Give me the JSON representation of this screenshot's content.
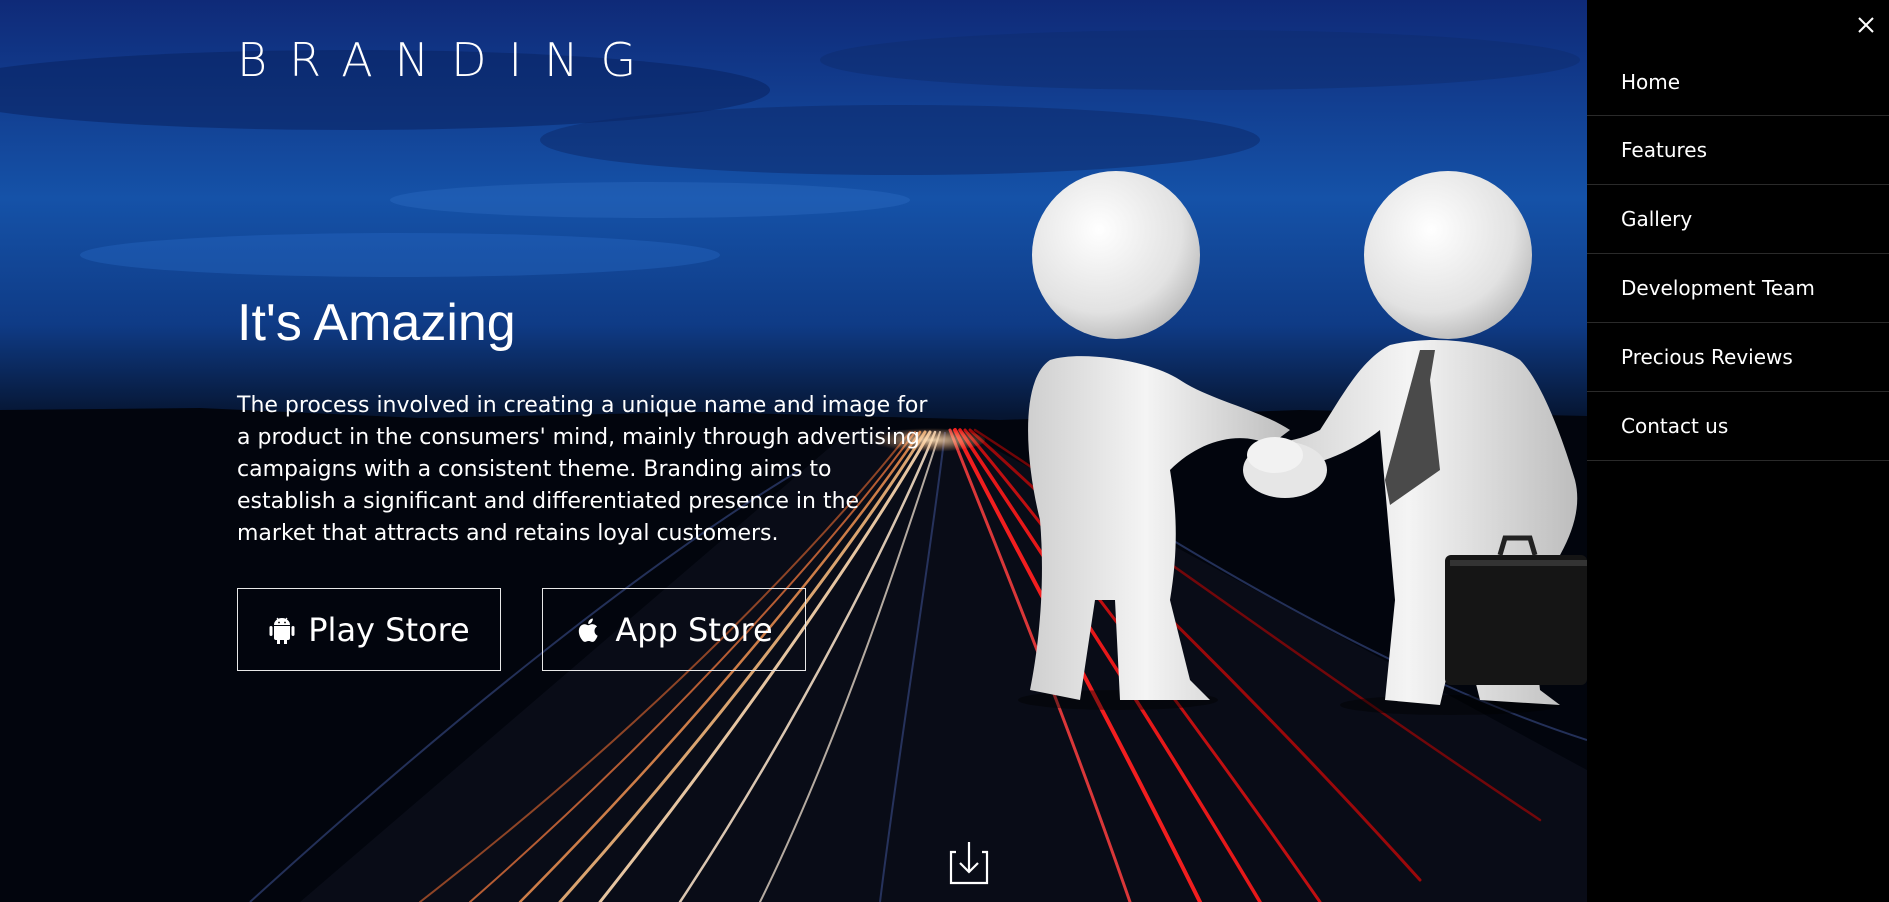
{
  "brand": {
    "logo_text": "BRANDING"
  },
  "hero": {
    "headline": "It's Amazing",
    "description": "The process involved in creating a unique name and image for a product in the consumers' mind, mainly through advertising campaigns with a consistent theme. Branding aims to establish a significant and differentiated presence in the market that attracts and retains loyal customers.",
    "buttons": {
      "play_store": {
        "label": "Play Store",
        "icon": "android-icon"
      },
      "app_store": {
        "label": "App Store",
        "icon": "apple-icon"
      }
    },
    "scroll_icon": "download-arrow-icon"
  },
  "sidebar": {
    "close_icon": "close-icon",
    "menu": [
      {
        "label": "Home"
      },
      {
        "label": "Features"
      },
      {
        "label": "Gallery"
      },
      {
        "label": "Development Team"
      },
      {
        "label": "Precious Reviews"
      },
      {
        "label": "Contact us"
      }
    ]
  },
  "colors": {
    "sky": "#1552a8",
    "night": "#020612",
    "sidebar_bg": "#000000",
    "light_trail_red": "#ff1a1a",
    "light_trail_warm": "#ffd0a0"
  }
}
